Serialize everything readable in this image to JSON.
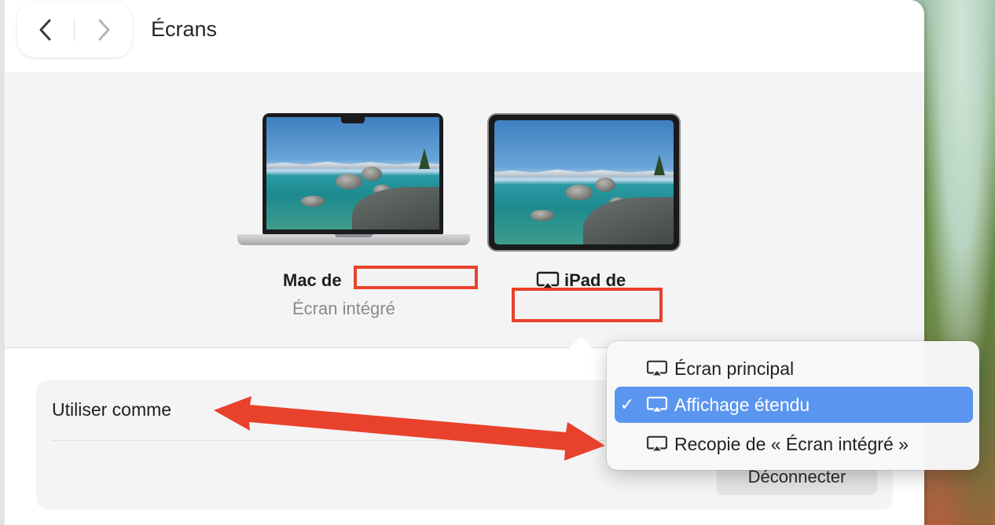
{
  "window": {
    "title": "Écrans"
  },
  "displays": [
    {
      "name": "Mac de",
      "subtitle": "Écran intégré"
    },
    {
      "name": "iPad de",
      "subtitle": ""
    }
  ],
  "settings": {
    "use_as_label": "Utiliser comme",
    "disconnect_label": "Déconnecter"
  },
  "menu": {
    "items": [
      {
        "label": "Écran principal",
        "checked": false
      },
      {
        "label": "Affichage étendu",
        "checked": true
      },
      {
        "label": "Recopie de « Écran intégré »",
        "checked": false
      }
    ],
    "check_glyph": "✓"
  },
  "colors": {
    "accent": "#5a95f0",
    "annotation": "#e8412c"
  },
  "icons": {
    "back": "chevron-left-icon",
    "forward": "chevron-right-icon",
    "airplay": "airplay-icon"
  }
}
